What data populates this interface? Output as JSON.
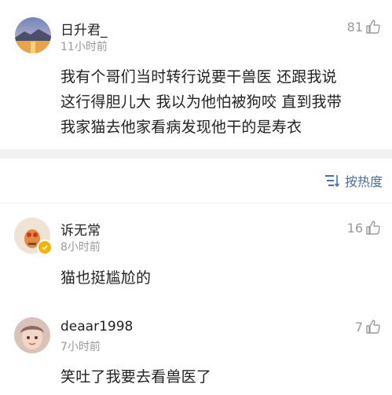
{
  "post": {
    "author": "日升君_",
    "time": "11小时前",
    "likes": "81",
    "lines": [
      "我有个哥们当时转行说要干兽医 还跟我说",
      "这行得胆儿大 我以为他怕被狗咬 直到我带",
      "我家猫去他家看病发现他干的是寿衣"
    ]
  },
  "sort": {
    "label": "按热度",
    "icon": "sort-icon"
  },
  "comments": [
    {
      "author": "诉无常",
      "time": "8小时前",
      "likes": "16",
      "text": "猫也挺尴尬的"
    },
    {
      "author": "deaar1998",
      "time": "7小时前",
      "likes": "7",
      "text": "笑吐了我要去看兽医了"
    }
  ],
  "colors": {
    "link": "#4a6ea8",
    "muted": "#999999",
    "badge": "#f4b400"
  }
}
